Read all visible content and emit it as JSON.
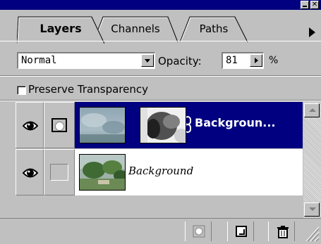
{
  "window": {
    "minimize_icon": "minimize-icon",
    "close_label": "✕"
  },
  "tabs": [
    {
      "label": "Layers",
      "active": true
    },
    {
      "label": "Channels",
      "active": false
    },
    {
      "label": "Paths",
      "active": false
    }
  ],
  "blend": {
    "mode": "Normal",
    "opacity_label": "Opacity:",
    "opacity_value": "81",
    "opacity_unit": "%"
  },
  "preserve_transparency": {
    "label": "Preserve Transparency",
    "checked": false
  },
  "layers": [
    {
      "name": "Backgroun...",
      "visible": true,
      "has_mask": true,
      "selected": true
    },
    {
      "name": "Background",
      "visible": true,
      "has_mask": false,
      "selected": false
    }
  ],
  "colors": {
    "selection": "#000080",
    "panel": "#c0c0c0",
    "titlebar": "#000080"
  },
  "toolbar": {
    "buttons": [
      "add-mask-icon",
      "new-layer-icon",
      "trash-icon"
    ]
  }
}
